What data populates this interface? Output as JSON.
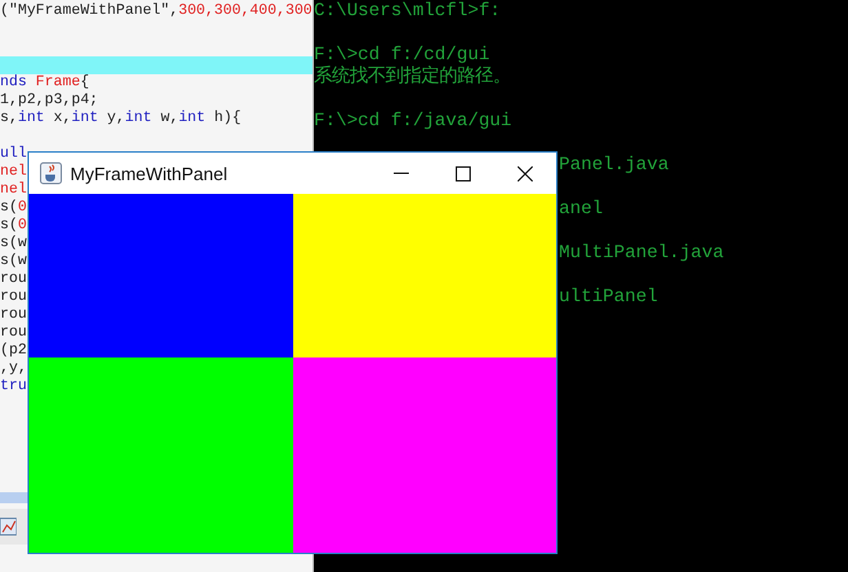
{
  "editor": {
    "lines": [
      {
        "kind": "code",
        "segments": [
          {
            "text": "(\"MyFrameWithPanel\",",
            "kind": "plain"
          },
          {
            "text": "300,300,400,300",
            "kind": "literal"
          }
        ]
      },
      {
        "kind": "blank"
      },
      {
        "kind": "blank"
      },
      {
        "kind": "highlight"
      },
      {
        "kind": "code",
        "segments": [
          {
            "text": "nds ",
            "kind": "keyword"
          },
          {
            "text": "Frame",
            "kind": "literal"
          },
          {
            "text": "{",
            "kind": "plain"
          }
        ]
      },
      {
        "kind": "code",
        "segments": [
          {
            "text": "1,p2,p3,p4;",
            "kind": "plain"
          }
        ]
      },
      {
        "kind": "code",
        "segments": [
          {
            "text": " s,",
            "kind": "plain"
          },
          {
            "text": "int",
            "kind": "keyword"
          },
          {
            "text": " x,",
            "kind": "plain"
          },
          {
            "text": "int",
            "kind": "keyword"
          },
          {
            "text": " y,",
            "kind": "plain"
          },
          {
            "text": "int",
            "kind": "keyword"
          },
          {
            "text": " w,",
            "kind": "plain"
          },
          {
            "text": "int",
            "kind": "keyword"
          },
          {
            "text": " h){",
            "kind": "plain"
          }
        ]
      },
      {
        "kind": "blank"
      },
      {
        "kind": "code",
        "segments": [
          {
            "text": "ull",
            "kind": "keyword"
          }
        ]
      },
      {
        "kind": "code",
        "segments": [
          {
            "text": "nel",
            "kind": "literal"
          }
        ]
      },
      {
        "kind": "code",
        "segments": [
          {
            "text": "nel",
            "kind": "literal"
          }
        ]
      },
      {
        "kind": "code",
        "segments": [
          {
            "text": "s(",
            "kind": "plain"
          },
          {
            "text": "0",
            "kind": "literal"
          }
        ]
      },
      {
        "kind": "code",
        "segments": [
          {
            "text": "s(",
            "kind": "plain"
          },
          {
            "text": "0",
            "kind": "literal"
          }
        ]
      },
      {
        "kind": "code",
        "segments": [
          {
            "text": "s(w",
            "kind": "plain"
          }
        ]
      },
      {
        "kind": "code",
        "segments": [
          {
            "text": "s(w",
            "kind": "plain"
          }
        ]
      },
      {
        "kind": "code",
        "segments": [
          {
            "text": "rou",
            "kind": "plain"
          }
        ]
      },
      {
        "kind": "code",
        "segments": [
          {
            "text": "rou",
            "kind": "plain"
          }
        ]
      },
      {
        "kind": "code",
        "segments": [
          {
            "text": "rou",
            "kind": "plain"
          }
        ]
      },
      {
        "kind": "code",
        "segments": [
          {
            "text": "rou",
            "kind": "plain"
          }
        ]
      },
      {
        "kind": "code",
        "segments": [
          {
            "text": "(p2",
            "kind": "plain"
          }
        ]
      },
      {
        "kind": "code",
        "segments": [
          {
            "text": ",y,",
            "kind": "plain"
          }
        ]
      },
      {
        "kind": "code",
        "segments": [
          {
            "text": "tru",
            "kind": "keyword"
          }
        ]
      }
    ]
  },
  "console": {
    "blocks": [
      [
        {
          "text": "C:\\Users\\mlcfl>f:",
          "kind": "full"
        }
      ],
      [
        {
          "text": "F:\\>cd f:/cd/gui",
          "kind": "full"
        },
        {
          "text": "系统找不到指定的路径。",
          "kind": "full"
        }
      ],
      [
        {
          "text": "F:\\>cd f:/java/gui",
          "kind": "full"
        }
      ],
      [
        {
          "text": "Panel.java",
          "kind": "partial"
        }
      ],
      [
        {
          "text": "anel",
          "kind": "partial"
        }
      ],
      [
        {
          "text": "MultiPanel.java",
          "kind": "partial"
        }
      ],
      [
        {
          "text": "ultiPanel",
          "kind": "partial"
        }
      ]
    ]
  },
  "frame": {
    "title": "MyFrameWithPanel",
    "panels": [
      {
        "color": "#0000ff"
      },
      {
        "color": "#ffff00"
      },
      {
        "color": "#00ff00"
      },
      {
        "color": "#ff00ff"
      }
    ]
  }
}
